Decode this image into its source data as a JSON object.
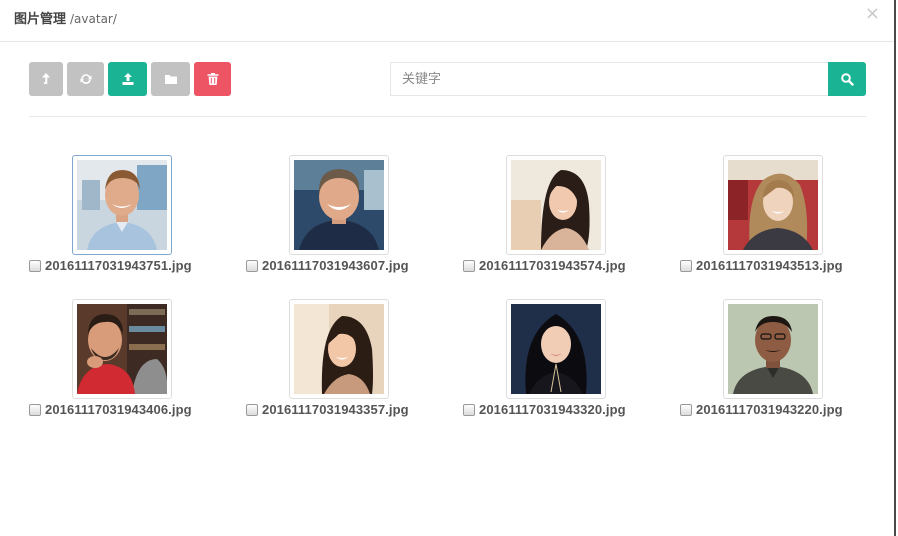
{
  "header": {
    "title": "图片管理",
    "path": "/avatar/",
    "close_label": "×"
  },
  "toolbar": {
    "buttons": [
      {
        "name": "go-up-button",
        "icon": "level-up-icon",
        "color": "#c2c2c2"
      },
      {
        "name": "refresh-button",
        "icon": "refresh-icon",
        "color": "#c2c2c2"
      },
      {
        "name": "upload-button",
        "icon": "upload-icon",
        "color": "#1ab394"
      },
      {
        "name": "new-folder-button",
        "icon": "folder-icon",
        "color": "#c2c2c2"
      },
      {
        "name": "delete-button",
        "icon": "trash-icon",
        "color": "#ed5565"
      }
    ]
  },
  "search": {
    "placeholder": "关键字",
    "value": "",
    "button_icon": "search-icon"
  },
  "files": [
    {
      "name": "20161117031943751.jpg",
      "selected": true,
      "checked": false
    },
    {
      "name": "20161117031943607.jpg",
      "selected": false,
      "checked": false
    },
    {
      "name": "20161117031943574.jpg",
      "selected": false,
      "checked": false
    },
    {
      "name": "20161117031943513.jpg",
      "selected": false,
      "checked": false
    },
    {
      "name": "20161117031943406.jpg",
      "selected": false,
      "checked": false
    },
    {
      "name": "20161117031943357.jpg",
      "selected": false,
      "checked": false
    },
    {
      "name": "20161117031943320.jpg",
      "selected": false,
      "checked": false
    },
    {
      "name": "20161117031943220.jpg",
      "selected": false,
      "checked": false
    }
  ],
  "colors": {
    "accent": "#1ab394",
    "danger": "#ed5565",
    "neutral": "#c2c2c2"
  }
}
